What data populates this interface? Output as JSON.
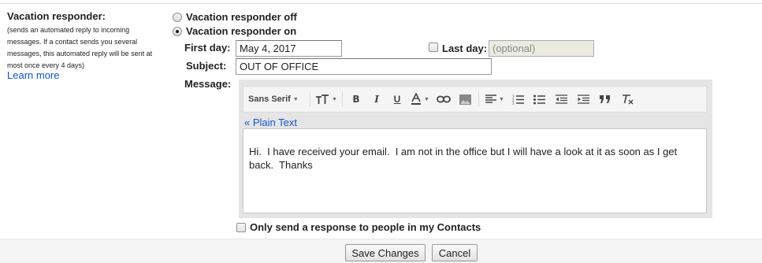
{
  "vacation": {
    "title": "Vacation responder:",
    "description": "(sends an automated reply to incoming messages. If a contact sends you several messages, this automated reply will be sent at most once every 4 days)",
    "learn_more": "Learn more",
    "option_off": "Vacation responder off",
    "option_on": "Vacation responder on",
    "selected": "on"
  },
  "form": {
    "first_day_label": "First day:",
    "first_day_value": "May 4, 2017",
    "last_day_label": "Last day:",
    "last_day_placeholder": "(optional)",
    "last_day_checked": false,
    "subject_label": "Subject:",
    "subject_value": "OUT OF OFFICE",
    "message_label": "Message:"
  },
  "toolbar": {
    "font_name": "Sans Serif",
    "font_size_icon": "text-size-icon",
    "icons": [
      "bold-icon",
      "italic-icon",
      "underline-icon",
      "text-color-icon",
      "link-icon",
      "image-icon",
      "align-icon",
      "numbered-list-icon",
      "bulleted-list-icon",
      "indent-less-icon",
      "indent-more-icon",
      "quote-icon",
      "remove-formatting-icon"
    ]
  },
  "editor": {
    "plain_text_link": "« Plain Text",
    "body": "Hi.  I have received your email.  I am not in the office but I will have a look at it as soon as I get back.  Thanks"
  },
  "contacts_only": {
    "label": "Only send a response to people in my Contacts",
    "checked": false
  },
  "buttons": {
    "save": "Save Changes",
    "cancel": "Cancel"
  }
}
